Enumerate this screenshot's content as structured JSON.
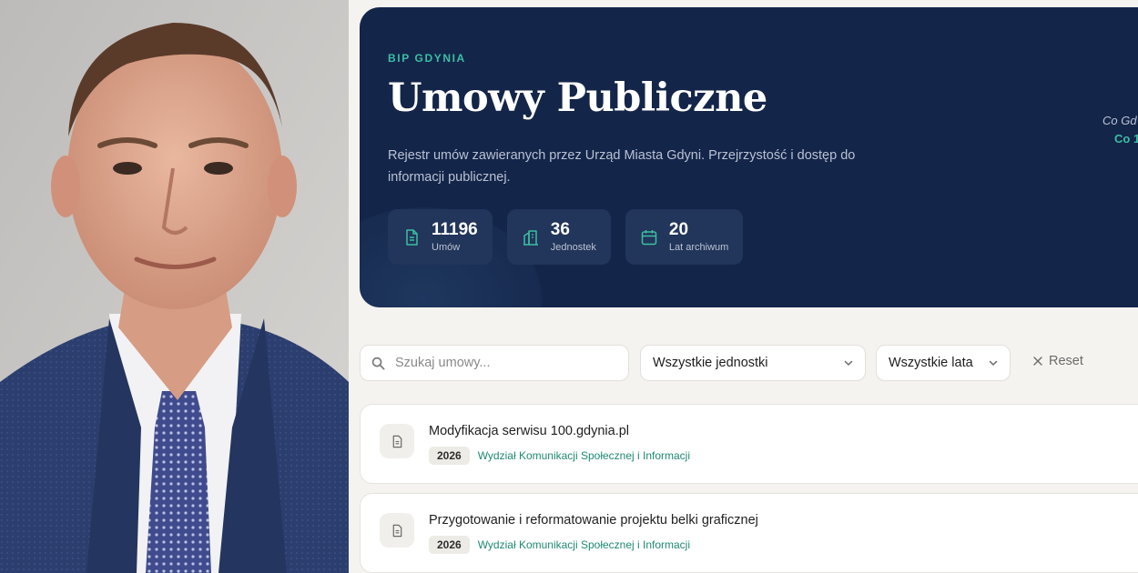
{
  "colors": {
    "hero_bg": "#14254a",
    "accent_teal": "#3bbfa3",
    "page_bg": "#f4f3f0",
    "dept_link": "#1f8a72"
  },
  "photo": {
    "icon": "portrait-photo"
  },
  "hero": {
    "eyebrow": "BIP GDYNIA",
    "title": "Umowy Publiczne",
    "description": "Rejestr umów zawieranych przez Urząd Miasta Gdyni. Przejrzystość i dostęp do informacji publicznej.",
    "side_text_1": "Co Gd",
    "side_text_2": "Co 1",
    "stats": [
      {
        "value": "11196",
        "label": "Umów",
        "icon": "document-icon"
      },
      {
        "value": "36",
        "label": "Jednostek",
        "icon": "building-icon"
      },
      {
        "value": "20",
        "label": "Lat archiwum",
        "icon": "calendar-icon"
      }
    ]
  },
  "filters": {
    "search_placeholder": "Szukaj umowy...",
    "units_selected": "Wszystkie jednostki",
    "years_selected": "Wszystkie lata",
    "reset_label": "Reset"
  },
  "contracts": [
    {
      "title": "Modyfikacja serwisu 100.gdynia.pl",
      "year": "2026",
      "department": "Wydział Komunikacji Społecznej i Informacji"
    },
    {
      "title": "Przygotowanie i reformatowanie projektu belki graficznej",
      "year": "2026",
      "department": "Wydział Komunikacji Społecznej i Informacji"
    }
  ]
}
